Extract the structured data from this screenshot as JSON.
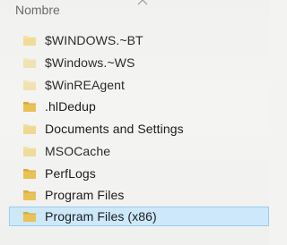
{
  "header": {
    "column_name": "Nombre",
    "sort_icon": "chevron-up-icon"
  },
  "items": [
    {
      "name": "$WINDOWS.~BT",
      "icon": "folder-icon",
      "hidden": true,
      "selected": false
    },
    {
      "name": "$Windows.~WS",
      "icon": "folder-icon",
      "hidden": true,
      "selected": false
    },
    {
      "name": "$WinREAgent",
      "icon": "folder-icon",
      "hidden": true,
      "selected": false
    },
    {
      "name": ".hlDedup",
      "icon": "folder-icon",
      "hidden": false,
      "selected": false
    },
    {
      "name": "Documents and Settings",
      "icon": "folder-shortcut-icon",
      "hidden": true,
      "selected": false
    },
    {
      "name": "MSOCache",
      "icon": "folder-icon",
      "hidden": true,
      "selected": false
    },
    {
      "name": "PerfLogs",
      "icon": "folder-icon",
      "hidden": false,
      "selected": false
    },
    {
      "name": "Program Files",
      "icon": "folder-icon",
      "hidden": false,
      "selected": false
    },
    {
      "name": "Program Files (x86)",
      "icon": "folder-icon",
      "hidden": false,
      "selected": true
    }
  ],
  "colors": {
    "folder": "#e7c358",
    "folder_dark": "#d4a93a",
    "folder_hidden": "#efe2b6",
    "selection_bg": "#cde8fb",
    "selection_border": "#99cdef"
  }
}
